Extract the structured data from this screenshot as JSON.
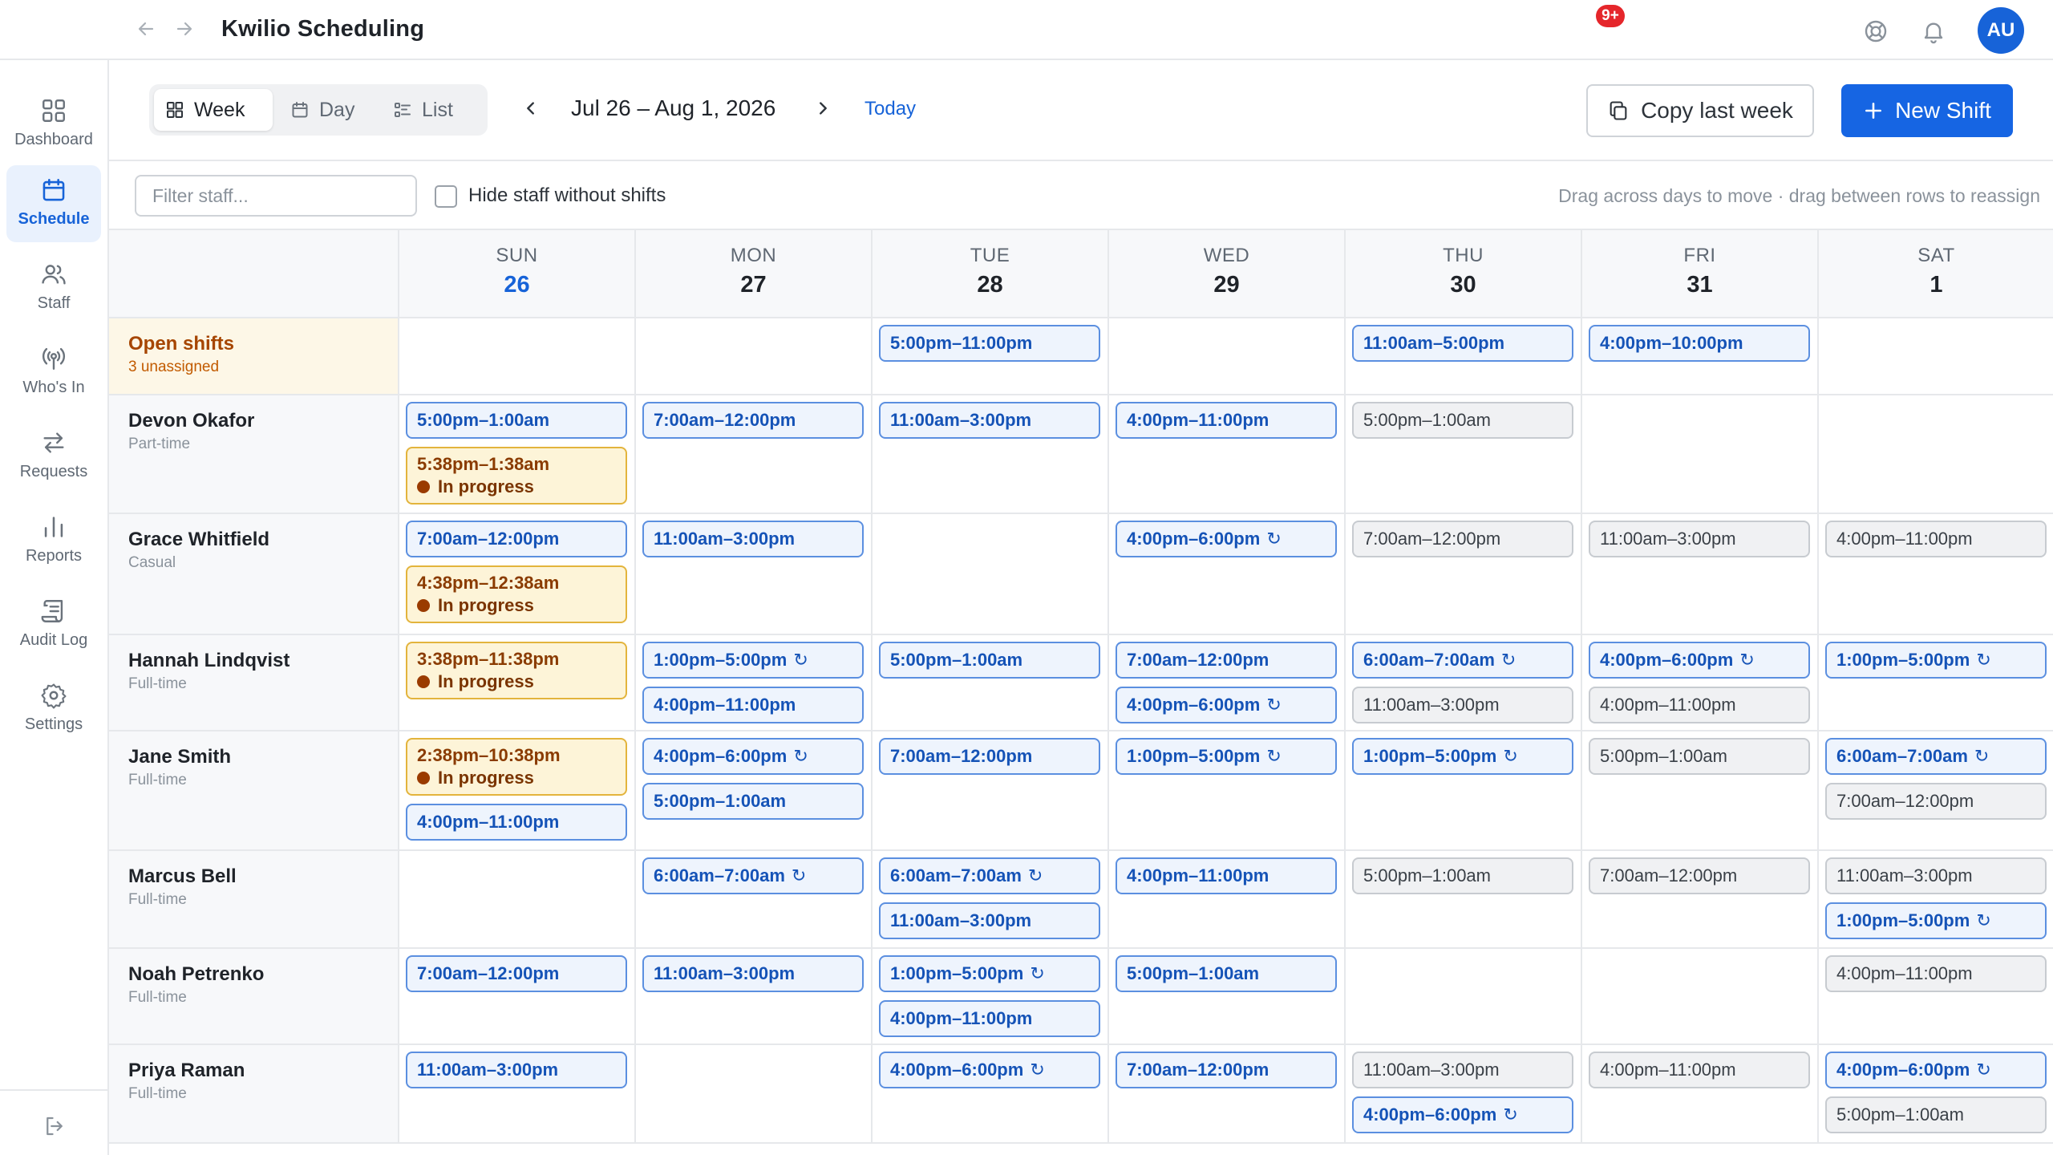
{
  "app": {
    "title": "Kwilio Scheduling",
    "badge": "9+",
    "avatar": "AU"
  },
  "sidebar": [
    {
      "label": "Dashboard",
      "icon": "dashboard-icon",
      "active": false
    },
    {
      "label": "Schedule",
      "icon": "calendar-icon",
      "active": true
    },
    {
      "label": "Staff",
      "icon": "users-icon",
      "active": false
    },
    {
      "label": "Who's In",
      "icon": "broadcast-icon",
      "active": false
    },
    {
      "label": "Requests",
      "icon": "swap-icon",
      "active": false
    },
    {
      "label": "Reports",
      "icon": "bar-chart-icon",
      "active": false
    },
    {
      "label": "Audit Log",
      "icon": "scroll-icon",
      "active": false
    },
    {
      "label": "Settings",
      "icon": "gear-icon",
      "active": false
    }
  ],
  "toolbar": {
    "views": [
      "Week",
      "Day",
      "List"
    ],
    "active_view": "Week",
    "date_range": "Jul 26 – Aug 1, 2026",
    "today": "Today",
    "copy_label": "Copy last week",
    "new_label": "New Shift"
  },
  "filter": {
    "placeholder": "Filter staff...",
    "checkbox_label": "Hide staff without shifts",
    "hint": "Drag across days to move · drag between rows to reassign"
  },
  "days": [
    {
      "name": "SUN",
      "num": "26",
      "today": true
    },
    {
      "name": "MON",
      "num": "27",
      "today": false
    },
    {
      "name": "TUE",
      "num": "28",
      "today": false
    },
    {
      "name": "WED",
      "num": "29",
      "today": false
    },
    {
      "name": "THU",
      "num": "30",
      "today": false
    },
    {
      "name": "FRI",
      "num": "31",
      "today": false
    },
    {
      "name": "SAT",
      "num": "1",
      "today": false
    }
  ],
  "colors": {
    "accent": "#1763d8",
    "in_progress": "#e3b43c",
    "badge": "#e5262b"
  },
  "progress_label": "In progress",
  "rows": [
    {
      "name": "Open shifts",
      "type": "3 unassigned",
      "open": true,
      "cells": [
        [],
        [],
        [
          {
            "time": "5:00pm–11:00pm"
          }
        ],
        [],
        [
          {
            "time": "11:00am–5:00pm"
          }
        ],
        [
          {
            "time": "4:00pm–10:00pm"
          }
        ],
        []
      ]
    },
    {
      "name": "Devon Okafor",
      "type": "Part-time",
      "cells": [
        [
          {
            "time": "5:00pm–1:00am"
          },
          {
            "time": "5:38pm–1:38am",
            "status": "progress"
          }
        ],
        [
          {
            "time": "7:00am–12:00pm"
          }
        ],
        [
          {
            "time": "11:00am–3:00pm"
          }
        ],
        [
          {
            "time": "4:00pm–11:00pm"
          }
        ],
        [
          {
            "time": "5:00pm–1:00am",
            "status": "past"
          }
        ],
        [],
        []
      ]
    },
    {
      "name": "Grace Whitfield",
      "type": "Casual",
      "cells": [
        [
          {
            "time": "7:00am–12:00pm"
          },
          {
            "time": "4:38pm–12:38am",
            "status": "progress"
          }
        ],
        [
          {
            "time": "11:00am–3:00pm"
          }
        ],
        [],
        [
          {
            "time": "4:00pm–6:00pm",
            "repeat": true
          }
        ],
        [
          {
            "time": "7:00am–12:00pm",
            "status": "past"
          }
        ],
        [
          {
            "time": "11:00am–3:00pm",
            "status": "past"
          }
        ],
        [
          {
            "time": "4:00pm–11:00pm",
            "status": "past"
          }
        ]
      ]
    },
    {
      "name": "Hannah Lindqvist",
      "type": "Full-time",
      "cells": [
        [
          {
            "time": "3:38pm–11:38pm",
            "status": "progress"
          }
        ],
        [
          {
            "time": "1:00pm–5:00pm",
            "repeat": true
          },
          {
            "time": "4:00pm–11:00pm"
          }
        ],
        [
          {
            "time": "5:00pm–1:00am"
          }
        ],
        [
          {
            "time": "7:00am–12:00pm"
          },
          {
            "time": "4:00pm–6:00pm",
            "repeat": true
          }
        ],
        [
          {
            "time": "6:00am–7:00am",
            "repeat": true
          },
          {
            "time": "11:00am–3:00pm",
            "status": "past"
          }
        ],
        [
          {
            "time": "4:00pm–6:00pm",
            "repeat": true
          },
          {
            "time": "4:00pm–11:00pm",
            "status": "past"
          }
        ],
        [
          {
            "time": "1:00pm–5:00pm",
            "repeat": true
          }
        ]
      ]
    },
    {
      "name": "Jane Smith",
      "type": "Full-time",
      "cells": [
        [
          {
            "time": "2:38pm–10:38pm",
            "status": "progress"
          },
          {
            "time": "4:00pm–11:00pm"
          }
        ],
        [
          {
            "time": "4:00pm–6:00pm",
            "repeat": true
          },
          {
            "time": "5:00pm–1:00am"
          }
        ],
        [
          {
            "time": "7:00am–12:00pm"
          }
        ],
        [
          {
            "time": "1:00pm–5:00pm",
            "repeat": true
          }
        ],
        [
          {
            "time": "1:00pm–5:00pm",
            "repeat": true
          }
        ],
        [
          {
            "time": "5:00pm–1:00am",
            "status": "past"
          }
        ],
        [
          {
            "time": "6:00am–7:00am",
            "repeat": true
          },
          {
            "time": "7:00am–12:00pm",
            "status": "past"
          }
        ]
      ]
    },
    {
      "name": "Marcus Bell",
      "type": "Full-time",
      "cells": [
        [],
        [
          {
            "time": "6:00am–7:00am",
            "repeat": true
          }
        ],
        [
          {
            "time": "6:00am–7:00am",
            "repeat": true
          },
          {
            "time": "11:00am–3:00pm"
          }
        ],
        [
          {
            "time": "4:00pm–11:00pm"
          }
        ],
        [
          {
            "time": "5:00pm–1:00am",
            "status": "past"
          }
        ],
        [
          {
            "time": "7:00am–12:00pm",
            "status": "past"
          }
        ],
        [
          {
            "time": "11:00am–3:00pm",
            "status": "past"
          },
          {
            "time": "1:00pm–5:00pm",
            "repeat": true
          }
        ]
      ]
    },
    {
      "name": "Noah Petrenko",
      "type": "Full-time",
      "cells": [
        [
          {
            "time": "7:00am–12:00pm"
          }
        ],
        [
          {
            "time": "11:00am–3:00pm"
          }
        ],
        [
          {
            "time": "1:00pm–5:00pm",
            "repeat": true
          },
          {
            "time": "4:00pm–11:00pm"
          }
        ],
        [
          {
            "time": "5:00pm–1:00am"
          }
        ],
        [],
        [],
        [
          {
            "time": "4:00pm–11:00pm",
            "status": "past"
          }
        ]
      ]
    },
    {
      "name": "Priya Raman",
      "type": "Full-time",
      "cells": [
        [
          {
            "time": "11:00am–3:00pm"
          }
        ],
        [],
        [
          {
            "time": "4:00pm–6:00pm",
            "repeat": true
          }
        ],
        [
          {
            "time": "7:00am–12:00pm"
          }
        ],
        [
          {
            "time": "11:00am–3:00pm",
            "status": "past"
          },
          {
            "time": "4:00pm–6:00pm",
            "repeat": true
          }
        ],
        [
          {
            "time": "4:00pm–11:00pm",
            "status": "past"
          }
        ],
        [
          {
            "time": "4:00pm–6:00pm",
            "repeat": true
          },
          {
            "time": "5:00pm–1:00am",
            "status": "past"
          }
        ]
      ]
    }
  ]
}
